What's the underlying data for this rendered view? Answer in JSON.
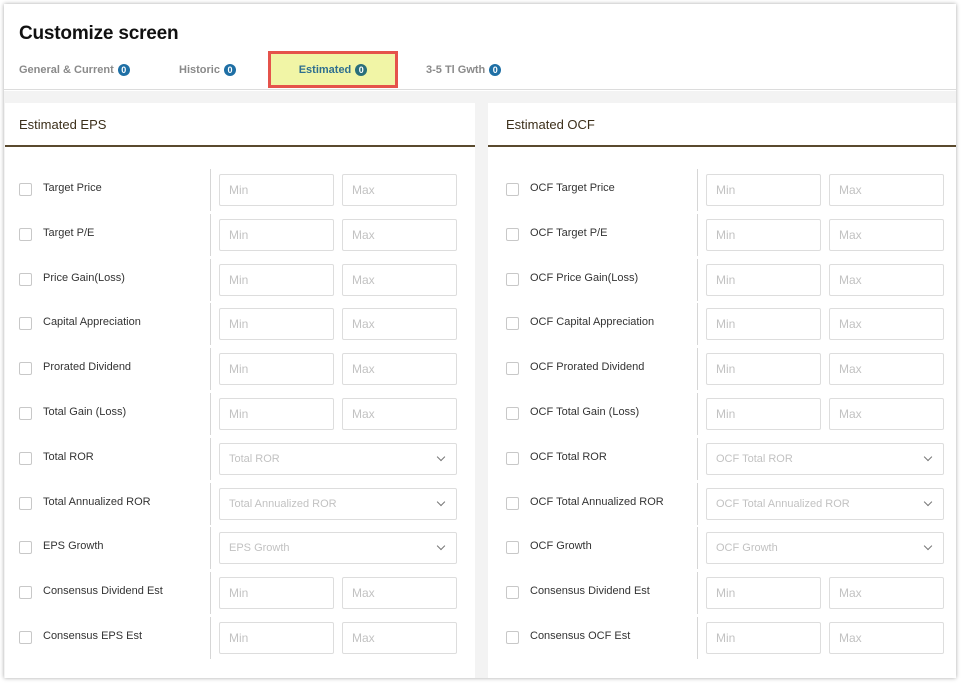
{
  "title": "Customize screen",
  "tabs": [
    {
      "label": "General & Current",
      "count": "0"
    },
    {
      "label": "Historic",
      "count": "0"
    },
    {
      "label": "Estimated",
      "count": "0"
    },
    {
      "label": "3-5 Tl Gwth",
      "count": "0"
    }
  ],
  "left": {
    "header": "Estimated EPS",
    "rows": [
      {
        "label": "Target Price",
        "min": "Min",
        "max": "Max"
      },
      {
        "label": "Target P/E",
        "min": "Min",
        "max": "Max"
      },
      {
        "label": "Price Gain(Loss)",
        "min": "Min",
        "max": "Max"
      },
      {
        "label": "Capital Appreciation",
        "min": "Min",
        "max": "Max"
      },
      {
        "label": "Prorated Dividend",
        "min": "Min",
        "max": "Max"
      },
      {
        "label": "Total Gain (Loss)",
        "min": "Min",
        "max": "Max"
      },
      {
        "label": "Total ROR",
        "select": "Total ROR"
      },
      {
        "label": "Total Annualized ROR",
        "select": "Total Annualized ROR"
      },
      {
        "label": "EPS Growth",
        "select": "EPS Growth"
      },
      {
        "label": "Consensus Dividend Est",
        "min": "Min",
        "max": "Max"
      },
      {
        "label": "Consensus EPS Est",
        "min": "Min",
        "max": "Max"
      }
    ]
  },
  "right": {
    "header": "Estimated OCF",
    "rows": [
      {
        "label": "OCF Target Price",
        "min": "Min",
        "max": "Max"
      },
      {
        "label": "OCF Target P/E",
        "min": "Min",
        "max": "Max"
      },
      {
        "label": "OCF Price Gain(Loss)",
        "min": "Min",
        "max": "Max"
      },
      {
        "label": "OCF Capital Appreciation",
        "min": "Min",
        "max": "Max"
      },
      {
        "label": "OCF Prorated Dividend",
        "min": "Min",
        "max": "Max"
      },
      {
        "label": "OCF Total Gain (Loss)",
        "min": "Min",
        "max": "Max"
      },
      {
        "label": "OCF Total ROR",
        "select": "OCF Total ROR"
      },
      {
        "label": "OCF Total Annualized ROR",
        "select": "OCF Total Annualized ROR"
      },
      {
        "label": "OCF Growth",
        "select": "OCF Growth"
      },
      {
        "label": "Consensus Dividend Est",
        "min": "Min",
        "max": "Max"
      },
      {
        "label": "Consensus OCF Est",
        "min": "Min",
        "max": "Max"
      }
    ]
  },
  "colors": {
    "active_tab_bg": "#f1f5a6",
    "active_tab_border": "#e5534b",
    "badge": "#1e6fa5",
    "header_rule": "#5a4a2e"
  }
}
